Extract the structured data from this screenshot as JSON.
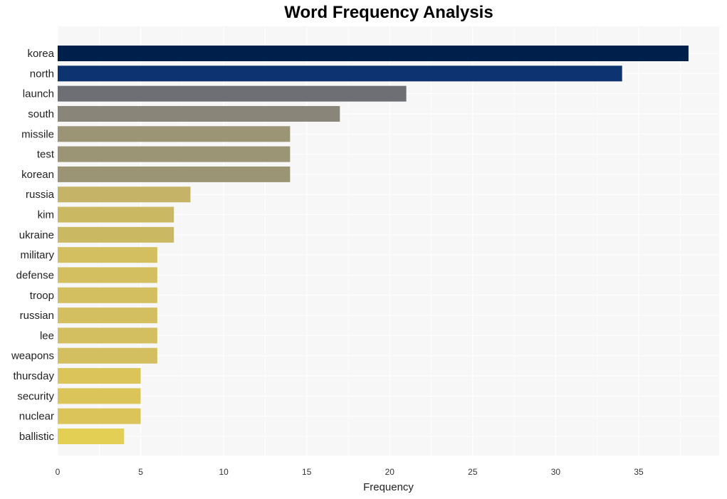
{
  "chart_data": {
    "type": "bar",
    "orientation": "horizontal",
    "title": "Word Frequency Analysis",
    "xlabel": "Frequency",
    "ylabel": "",
    "xlim": [
      0,
      40
    ],
    "xticks": [
      0,
      5,
      10,
      15,
      20,
      25,
      30,
      35
    ],
    "grid": true,
    "legend": "none",
    "categories": [
      "korea",
      "north",
      "launch",
      "south",
      "missile",
      "test",
      "korean",
      "russia",
      "kim",
      "ukraine",
      "military",
      "defense",
      "troop",
      "russian",
      "lee",
      "weapons",
      "thursday",
      "security",
      "nuclear",
      "ballistic"
    ],
    "values": [
      38,
      34,
      21,
      17,
      14,
      14,
      14,
      8,
      7,
      7,
      6,
      6,
      6,
      6,
      6,
      6,
      5,
      5,
      5,
      4
    ],
    "colors": [
      "#00204c",
      "#0d3370",
      "#6e6f74",
      "#898578",
      "#9b9475",
      "#9b9475",
      "#9b9475",
      "#c5b468",
      "#cbb863",
      "#cbb863",
      "#d3be60",
      "#d3be60",
      "#d3be60",
      "#d3be60",
      "#d3be60",
      "#d3be60",
      "#dbc45a",
      "#dbc45a",
      "#dbc45a",
      "#e4cf55"
    ]
  },
  "style": {
    "plot_background": "#f7f7f7",
    "grid_color": "#ffffff"
  }
}
